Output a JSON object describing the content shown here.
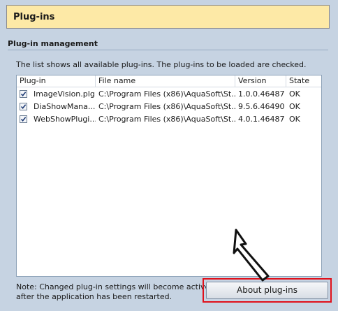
{
  "header": {
    "title": "Plug-ins"
  },
  "section": {
    "title": "Plug-in management",
    "description": "The list shows all available plug-ins. The plug-ins to be loaded are checked."
  },
  "table": {
    "columns": [
      "Plug-in",
      "File name",
      "Version",
      "State"
    ],
    "rows": [
      {
        "checked": true,
        "name": "ImageVision.plg",
        "file": "C:\\Program Files (x86)\\AquaSoft\\St...",
        "version": "1.0.0.46487",
        "state": "OK"
      },
      {
        "checked": true,
        "name": "DiaShowMana...",
        "file": "C:\\Program Files (x86)\\AquaSoft\\St...",
        "version": "9.5.6.46490",
        "state": "OK"
      },
      {
        "checked": true,
        "name": "WebShowPlugi...",
        "file": "C:\\Program Files (x86)\\AquaSoft\\St...",
        "version": "4.0.1.46487",
        "state": "OK"
      }
    ]
  },
  "note": {
    "line1": "Note: Changed plug-in settings will become active only",
    "line2": "after the application has been restarted."
  },
  "buttons": {
    "about": "About plug-ins"
  },
  "icons": {
    "checkbox": "checkmark-icon",
    "pointer": "arrow-cursor-icon"
  },
  "colors": {
    "header_bg": "#fde9a6",
    "highlight": "#e0101a",
    "panel_bg": "#c6d3e2"
  }
}
